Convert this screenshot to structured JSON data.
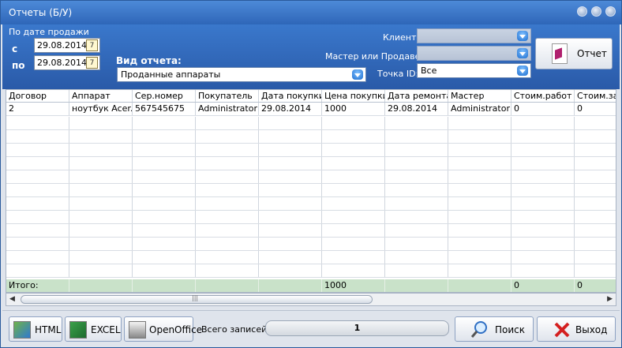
{
  "window": {
    "title": "Отчеты (Б/У)"
  },
  "filters": {
    "by_sale_date_label": "По дате продажи",
    "from_label": "с",
    "to_label": "по",
    "date_from": "29.08.2014",
    "date_to": "29.08.2014",
    "report_type_label": "Вид отчета:",
    "report_type_value": "Проданные аппараты",
    "client_label": "Клиент:",
    "client_value": "",
    "master_label": "Мастер или Продавец:",
    "master_value": "",
    "point_label": "Точка ID:",
    "point_value": "Все",
    "report_button": "Отчет"
  },
  "table": {
    "columns": [
      "Договор",
      "Аппарат",
      "Сер.номер",
      "Покупатель",
      "Дата покупки",
      "Цена покупки",
      "Дата ремонта",
      "Мастер",
      "Стоим.работ",
      "Стоим.зап"
    ],
    "rows": [
      [
        "2",
        "ноутбук Acer...",
        "567545675",
        "Administrator",
        "29.08.2014",
        "1000",
        "29.08.2014",
        "Administrator",
        "0",
        "0"
      ]
    ],
    "footer": [
      "Итого:",
      "",
      "",
      "",
      "",
      "1000",
      "",
      "",
      "0",
      "0"
    ]
  },
  "toolbar": {
    "html_label": "HTML",
    "excel_label": "EXCEL",
    "openoffice_label": "OpenOffice",
    "total_label": "Всего записей:",
    "total_value": "1",
    "search_label": "Поиск",
    "exit_label": "Выход"
  },
  "colors": {
    "title_bar": "#2e66b8",
    "footer_row": "#c9e2c9",
    "exit_icon": "#d42020"
  }
}
